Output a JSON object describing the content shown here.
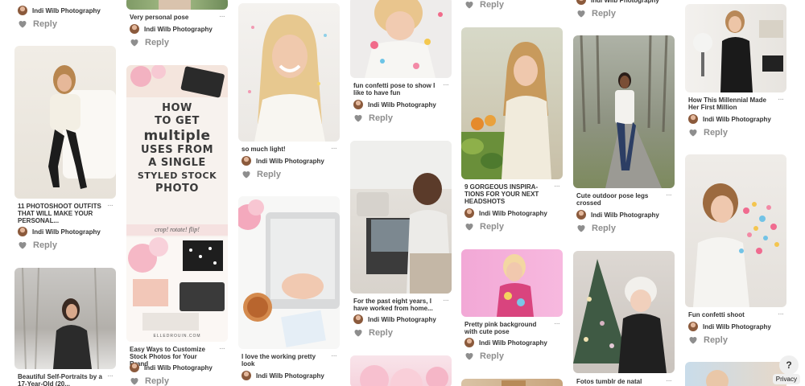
{
  "author_name": "Indi Wilb Photography",
  "reply_label": "Reply",
  "help_label": "?",
  "privacy_label": "Privacy",
  "pins": [
    {
      "title": "11 PHOTOSHOOT OUTFITS THAT WILL MAKE YOUR PERSONAL...",
      "image": "woman-seated-white-chair"
    },
    {
      "title": "Beautiful Self-Portraits by a 17-Year-Old (20...",
      "image": "woman-in-snow"
    },
    {
      "title": "Very personal pose",
      "image": "cropped-pose-photo"
    },
    {
      "title": "Easy Ways to Customize Stock Photos for Your Brand",
      "image": "styled-stock-photo-pin"
    },
    {
      "title": "so much light!",
      "image": "smiling-blonde-woman"
    },
    {
      "title": "I love the working pretty look",
      "image": "laptop-desk-flatlay"
    },
    {
      "title": "fun confetti pose to show I like to have fun",
      "image": "confetti-woman-cropped"
    },
    {
      "title": "For the past eight years, I have worked from home...",
      "image": "woman-working-laptop-couch"
    },
    {
      "title": "9 GORGEOUS INSPIRA- TIONS FOR YOUR NEXT HEADSHOTS",
      "image": "woman-market-produce"
    },
    {
      "title": "Pretty pink background with cute pose",
      "image": "woman-pink-background"
    },
    {
      "title": "Cute outdoor pose legs crossed",
      "image": "woman-outdoor-path"
    },
    {
      "title": "Fotos tumblr de natal",
      "image": "christmas-tree-photo"
    },
    {
      "title": "How This Millennial Made Her First Million",
      "image": "woman-black-outfit-interior"
    },
    {
      "title": "Fun confetti shoot",
      "image": "woman-blowing-confetti"
    }
  ],
  "stock_photo_pin": {
    "headline": [
      "HOW",
      "TO GET",
      "multiple",
      "USES FROM",
      "A SINGLE",
      "STYLED STOCK",
      "PHOTO"
    ],
    "band": "crop! rotate! flip!",
    "site": "ELLEDROUIN.COM"
  }
}
